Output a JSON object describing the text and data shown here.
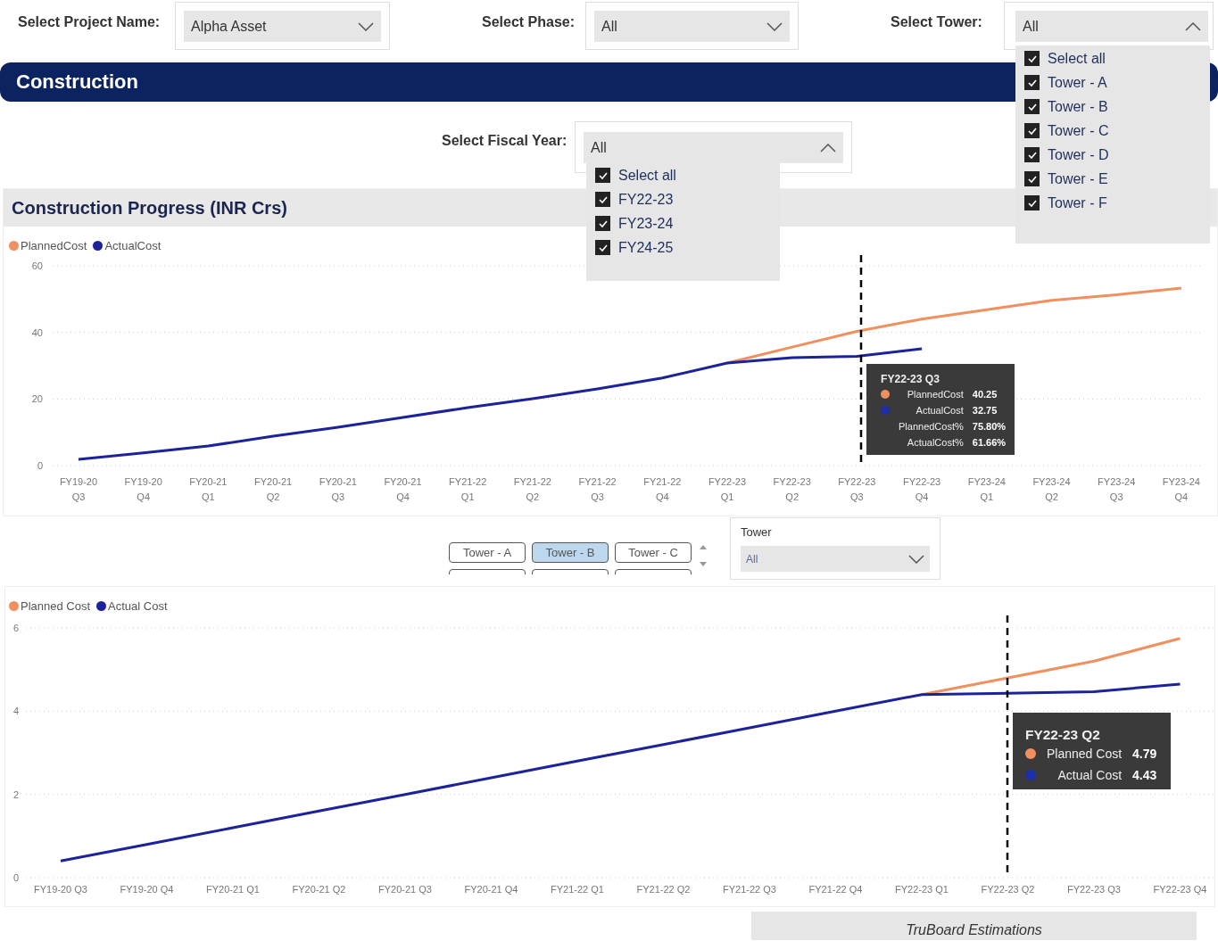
{
  "filters": [
    {
      "label": "Select Project Name:",
      "value": "Alpha Asset",
      "expanded": false
    },
    {
      "label": "Select Phase:",
      "value": "All",
      "expanded": false
    },
    {
      "label": "Select Tower:",
      "value": "All",
      "expanded": true,
      "options": [
        {
          "label": "Select all",
          "checked": true
        },
        {
          "label": "Tower - A",
          "checked": true
        },
        {
          "label": "Tower - B",
          "checked": true
        },
        {
          "label": "Tower - C",
          "checked": true
        },
        {
          "label": "Tower - D",
          "checked": true
        },
        {
          "label": "Tower - E",
          "checked": true
        },
        {
          "label": "Tower - F",
          "checked": true
        }
      ]
    }
  ],
  "banner": {
    "title": "Construction"
  },
  "fiscal_year_filter": {
    "label": "Select Fiscal Year:",
    "value": "All",
    "expanded": true,
    "options": [
      {
        "label": "Select all",
        "checked": true
      },
      {
        "label": "FY22-23",
        "checked": true
      },
      {
        "label": "FY23-24",
        "checked": true
      },
      {
        "label": "FY24-25",
        "checked": true
      }
    ]
  },
  "progress_panel": {
    "title": "Construction Progress (INR Crs)",
    "chart_data": {
      "type": "line",
      "categories": [
        "FY19-20 Q3",
        "FY19-20 Q4",
        "FY20-21 Q1",
        "FY20-21 Q2",
        "FY20-21 Q3",
        "FY20-21 Q4",
        "FY21-22 Q1",
        "FY21-22 Q2",
        "FY21-22 Q3",
        "FY21-22 Q4",
        "FY22-23 Q1",
        "FY22-23 Q2",
        "FY22-23 Q3",
        "FY22-23 Q4",
        "FY23-24 Q1",
        "FY23-24 Q2",
        "FY23-24 Q3",
        "FY23-24 Q4"
      ],
      "series": [
        {
          "name": "PlannedCost",
          "color": "#f0905e",
          "values": [
            null,
            null,
            null,
            null,
            null,
            null,
            null,
            null,
            null,
            null,
            30.8,
            35.6,
            40.3,
            44.0,
            46.8,
            49.6,
            51.3,
            53.3
          ]
        },
        {
          "name": "ActualCost",
          "color": "#1c229c",
          "values": [
            1.9,
            3.8,
            5.9,
            8.8,
            11.5,
            14.5,
            17.4,
            20.1,
            23.0,
            26.3,
            30.8,
            32.4,
            32.8,
            35.1,
            null,
            null,
            null,
            null
          ]
        }
      ],
      "ylim": [
        0,
        60
      ],
      "yticks": [
        0,
        20,
        40,
        60
      ]
    },
    "tooltip": {
      "title": "FY22-23 Q3",
      "rows": [
        {
          "label": "PlannedCost",
          "value": "40.25",
          "color": "#f0905e"
        },
        {
          "label": "ActualCost",
          "value": "32.75",
          "color": "#1c2ea8"
        },
        {
          "label": "PlannedCost%",
          "value": "75.80%"
        },
        {
          "label": "ActualCost%",
          "value": "61.66%"
        }
      ]
    }
  },
  "tower_slicer": {
    "tiles": [
      {
        "label": "Tower - A",
        "selected": false
      },
      {
        "label": "Tower - B",
        "selected": true
      },
      {
        "label": "Tower - C",
        "selected": false
      }
    ]
  },
  "tower_dropdown": {
    "label": "Tower",
    "value": "All"
  },
  "tower_chart": {
    "chart_data": {
      "type": "line",
      "categories": [
        "FY19-20 Q3",
        "FY19-20 Q4",
        "FY20-21 Q1",
        "FY20-21 Q2",
        "FY20-21 Q3",
        "FY20-21 Q4",
        "FY21-22 Q1",
        "FY21-22 Q2",
        "FY21-22 Q3",
        "FY21-22 Q4",
        "FY22-23 Q1",
        "FY22-23 Q2",
        "FY22-23 Q3",
        "FY22-23 Q4"
      ],
      "series": [
        {
          "name": "Planned Cost",
          "color": "#f0905e",
          "values": [
            null,
            null,
            null,
            null,
            null,
            null,
            null,
            null,
            null,
            null,
            4.4,
            4.8,
            5.2,
            5.75
          ]
        },
        {
          "name": "Actual Cost",
          "color": "#1c229c",
          "values": [
            0.4,
            0.8,
            1.2,
            1.6,
            2.0,
            2.4,
            2.8,
            3.2,
            3.6,
            4.0,
            4.4,
            4.43,
            4.47,
            4.65
          ]
        }
      ],
      "ylim": [
        0,
        6
      ],
      "yticks": [
        0,
        2,
        4,
        6
      ]
    },
    "tooltip": {
      "title": "FY22-23 Q2",
      "rows": [
        {
          "label": "Planned Cost",
          "value": "4.79",
          "color": "#f0905e"
        },
        {
          "label": "Actual Cost",
          "value": "4.43",
          "color": "#1c2ea8"
        }
      ]
    }
  },
  "bottom_tab": {
    "label": "TruBoard Estimations"
  }
}
